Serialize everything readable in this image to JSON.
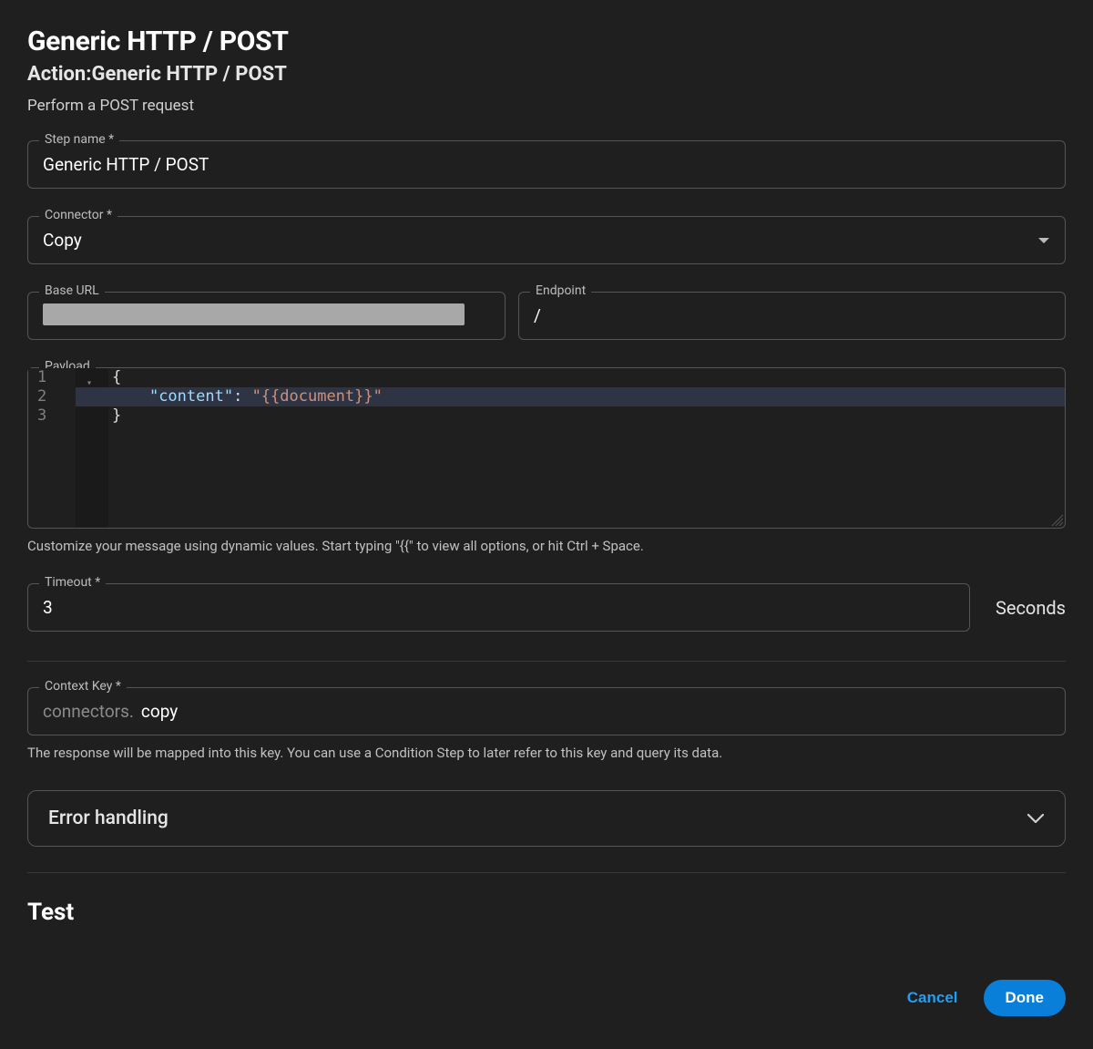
{
  "header": {
    "title": "Generic HTTP / POST",
    "subtitle_prefix": "Action:",
    "action_name": "Generic HTTP / POST",
    "description": "Perform a POST request"
  },
  "fields": {
    "step_name": {
      "label": "Step name *",
      "value": "Generic HTTP / POST"
    },
    "connector": {
      "label": "Connector *",
      "value": "Copy"
    },
    "base_url": {
      "label": "Base URL",
      "value": ""
    },
    "endpoint": {
      "label": "Endpoint",
      "value": "/"
    },
    "payload": {
      "label": "Payload",
      "lines": [
        "{",
        "    \"content\": \"{{document}}\"",
        "}"
      ],
      "helper": "Customize your message using dynamic values. Start typing \"{{\" to view all options, or hit Ctrl + Space."
    },
    "timeout": {
      "label": "Timeout *",
      "value": "3",
      "unit": "Seconds"
    },
    "context_key": {
      "label": "Context Key *",
      "prefix": "connectors.",
      "value": "copy",
      "helper": "The response will be mapped into this key. You can use a Condition Step to later refer to this key and query its data."
    },
    "error_handling": {
      "label": "Error handling"
    }
  },
  "sections": {
    "test": "Test"
  },
  "footer": {
    "cancel": "Cancel",
    "done": "Done"
  }
}
